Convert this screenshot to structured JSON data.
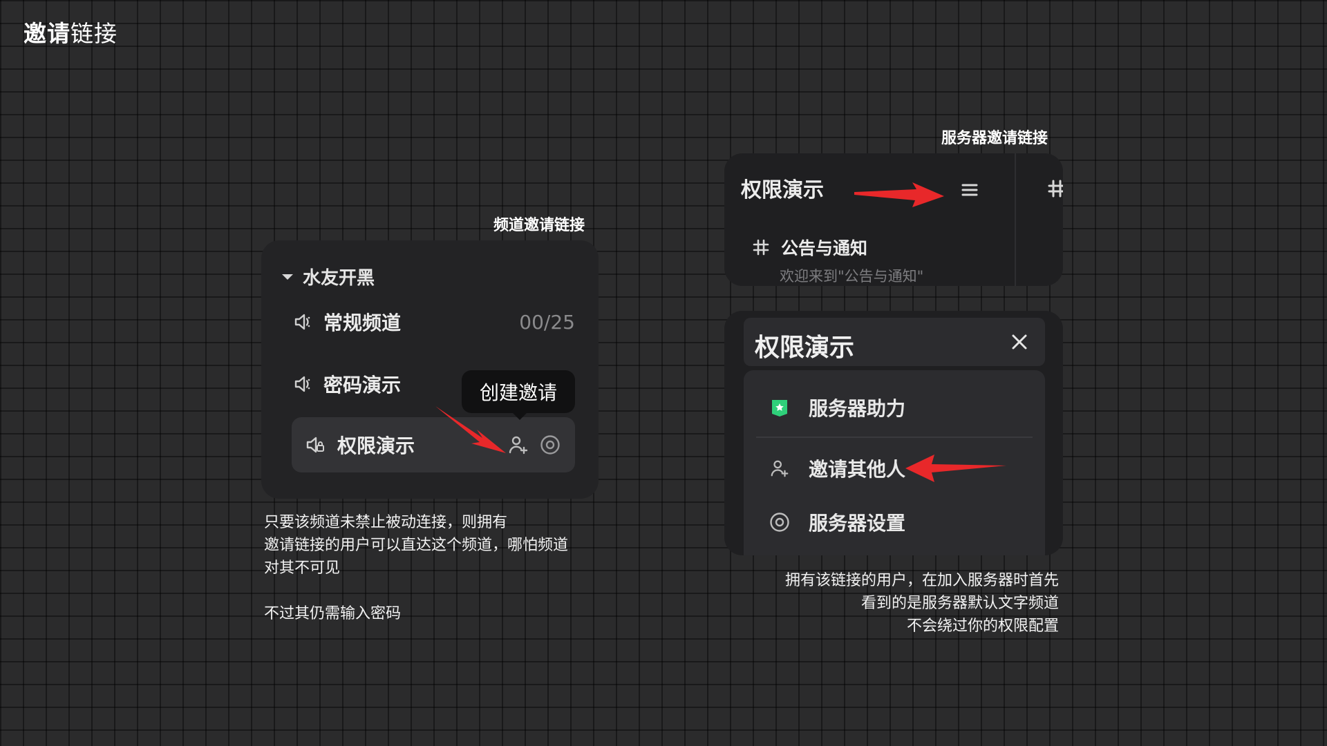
{
  "page": {
    "title_bold": "邀请",
    "title_rest": "链接"
  },
  "channel_invite": {
    "caption": "频道邀请链接",
    "category": "水友开黑",
    "channels": [
      {
        "label": "常规频道",
        "count": "00/25"
      },
      {
        "label": "密码演示"
      },
      {
        "label": "权限演示"
      }
    ],
    "tooltip": "创建邀请",
    "description": [
      "只要该频道未禁止被动连接，则拥有",
      "邀请链接的用户可以直达这个频道，哪怕频道",
      "对其不可见",
      "",
      "不过其仍需输入密码"
    ]
  },
  "server_invite": {
    "caption": "服务器邀请链接",
    "top_panel": {
      "title": "权限演示",
      "channel_label": "公告与通知",
      "channel_desc": "欢迎来到\"公告与通知\""
    },
    "menu_panel": {
      "title": "权限演示",
      "items": [
        {
          "label": "服务器助力",
          "icon": "boost-icon"
        },
        {
          "label": "邀请其他人",
          "icon": "invite-user-icon"
        },
        {
          "label": "服务器设置",
          "icon": "settings-icon"
        }
      ]
    },
    "description": [
      "拥有该链接的用户，在加入服务器时首先",
      "看到的是服务器默认文字频道",
      "不会绕过你的权限配置"
    ]
  },
  "colors": {
    "accent_red": "#e8282a",
    "boost_green": "#2fd07a"
  }
}
